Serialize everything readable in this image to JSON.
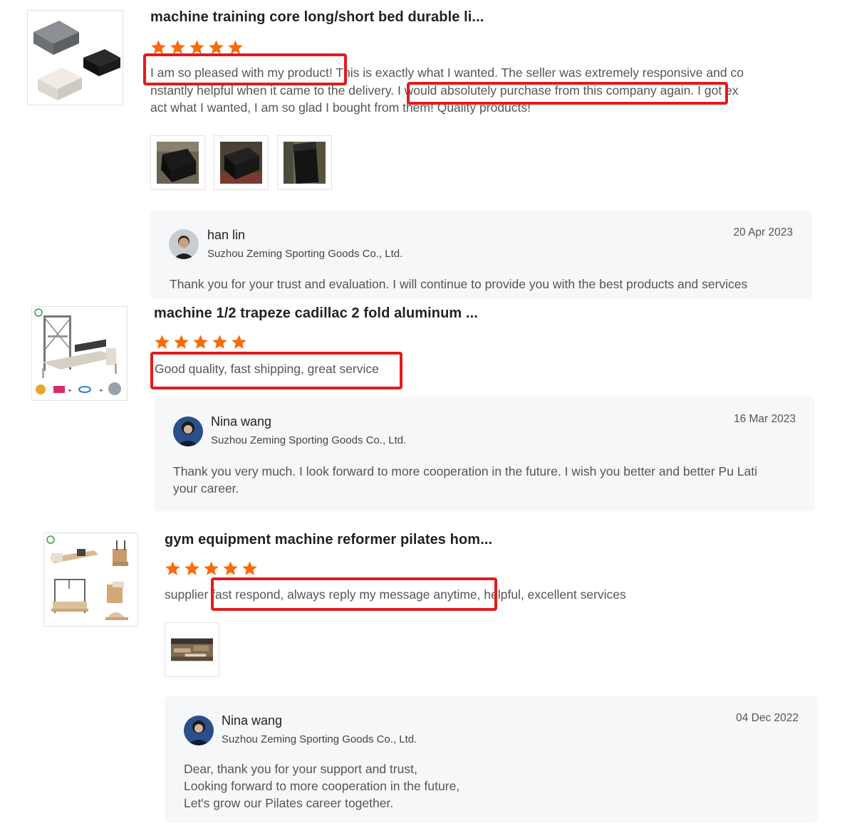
{
  "colors": {
    "star": "#f96a0a",
    "highlight": "#e31b1b",
    "reply_bg": "#f6f7f9"
  },
  "reviews": [
    {
      "product_title": "machine training core long/short bed durable li...",
      "rating": 5,
      "text_lines": [
        "I am so pleased with my product! This is exactly what I wanted. The seller was extremely responsive and co",
        "nstantly helpful when it came to the delivery. I would absolutely purchase from this company again. I got ex",
        "act what I wanted, I am so glad I bought from them! Quality products!"
      ],
      "highlights": [
        "I am so pleased with my product!",
        "I would absolutely purchase from this company again."
      ],
      "photo_count": 3,
      "reply": {
        "name": "han lin",
        "company": "Suzhou Zeming Sporting Goods Co., Ltd.",
        "date": "20 Apr 2023",
        "text_lines": [
          "Thank you for your trust and evaluation. I will continue to provide you with the best products and services"
        ]
      }
    },
    {
      "product_title": "machine 1/2 trapeze cadillac 2 fold aluminum ...",
      "rating": 5,
      "text_lines": [
        "Good quality, fast shipping, great service"
      ],
      "highlights": [
        "Good quality, fast shipping, great service"
      ],
      "photo_count": 0,
      "reply": {
        "name": "Nina wang",
        "company": "Suzhou Zeming Sporting Goods Co., Ltd.",
        "date": "16 Mar 2023",
        "text_lines": [
          "Thank you very much. I look forward to more cooperation in the future. I wish you better and better Pu Lati",
          "your career."
        ]
      }
    },
    {
      "product_title": "gym equipment machine reformer pilates hom...",
      "rating": 5,
      "text_lines": [
        "supplier fast respond, always reply my message anytime, helpful, excellent services"
      ],
      "highlights": [
        "fast respond, always reply my message anytime,"
      ],
      "photo_count": 1,
      "reply": {
        "name": "Nina wang",
        "company": "Suzhou Zeming Sporting Goods Co., Ltd.",
        "date": "04 Dec 2022",
        "text_lines": [
          "Dear, thank you for your support and trust,",
          "Looking forward to more cooperation in the future,",
          "Let's grow our Pilates career together."
        ]
      }
    }
  ]
}
